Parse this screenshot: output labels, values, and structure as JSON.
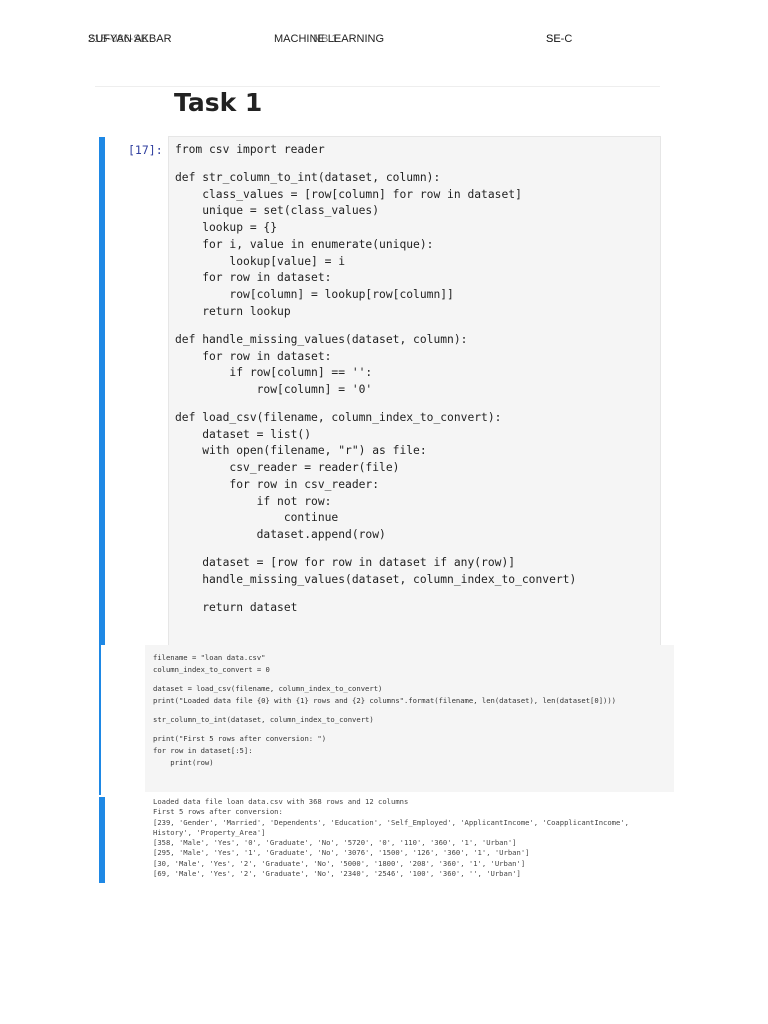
{
  "header": {
    "name": "SUFYAN AKBAR",
    "name_overlap": "21B-086-SE",
    "course": "MACHINE LEARNING",
    "course_overlap": "NB 1",
    "section": "SE-C",
    "section_overlap": "SE"
  },
  "title": "Task 1",
  "cell1": {
    "prompt": "[17]:",
    "lines": [
      "from csv import reader",
      "",
      "def str_column_to_int(dataset, column):",
      "    class_values = [row[column] for row in dataset]",
      "    unique = set(class_values)",
      "    lookup = {}",
      "    for i, value in enumerate(unique):",
      "        lookup[value] = i",
      "    for row in dataset:",
      "        row[column] = lookup[row[column]]",
      "    return lookup",
      "",
      "def handle_missing_values(dataset, column):",
      "    for row in dataset:",
      "        if row[column] == '':",
      "            row[column] = '0'",
      "",
      "def load_csv(filename, column_index_to_convert):",
      "    dataset = list()",
      "    with open(filename, \"r\") as file:",
      "        csv_reader = reader(file)",
      "        for row in csv_reader:",
      "            if not row:",
      "                continue",
      "            dataset.append(row)",
      "",
      "    dataset = [row for row in dataset if any(row)]",
      "    handle_missing_values(dataset, column_index_to_convert)",
      "",
      "    return dataset"
    ]
  },
  "cell2": {
    "lines": [
      "filename = \"loan data.csv\"",
      "column_index_to_convert = 0",
      "",
      "dataset = load_csv(filename, column_index_to_convert)",
      "print(\"Loaded data file {0} with {1} rows and {2} columns\".format(filename, len(dataset), len(dataset[0])))",
      "",
      "str_column_to_int(dataset, column_index_to_convert)",
      "",
      "print(\"First 5 rows after conversion: \")",
      "for row in dataset[:5]:",
      "    print(row)"
    ]
  },
  "output": {
    "lines": [
      "Loaded data file loan data.csv with 368 rows and 12 columns",
      "First 5 rows after conversion:",
      "[239, 'Gender', 'Married', 'Dependents', 'Education', 'Self_Employed', 'ApplicantIncome', 'CoapplicantIncome',",
      "History', 'Property_Area']",
      "[358, 'Male', 'Yes', '0', 'Graduate', 'No', '5720', '0', '110', '360', '1', 'Urban']",
      "[295, 'Male', 'Yes', '1', 'Graduate', 'No', '3076', '1500', '126', '360', '1', 'Urban']",
      "[30, 'Male', 'Yes', '2', 'Graduate', 'No', '5000', '1800', '208', '360', '1', 'Urban']",
      "[69, 'Male', 'Yes', '2', 'Graduate', 'No', '2340', '2546', '100', '360', '', 'Urban']"
    ]
  }
}
